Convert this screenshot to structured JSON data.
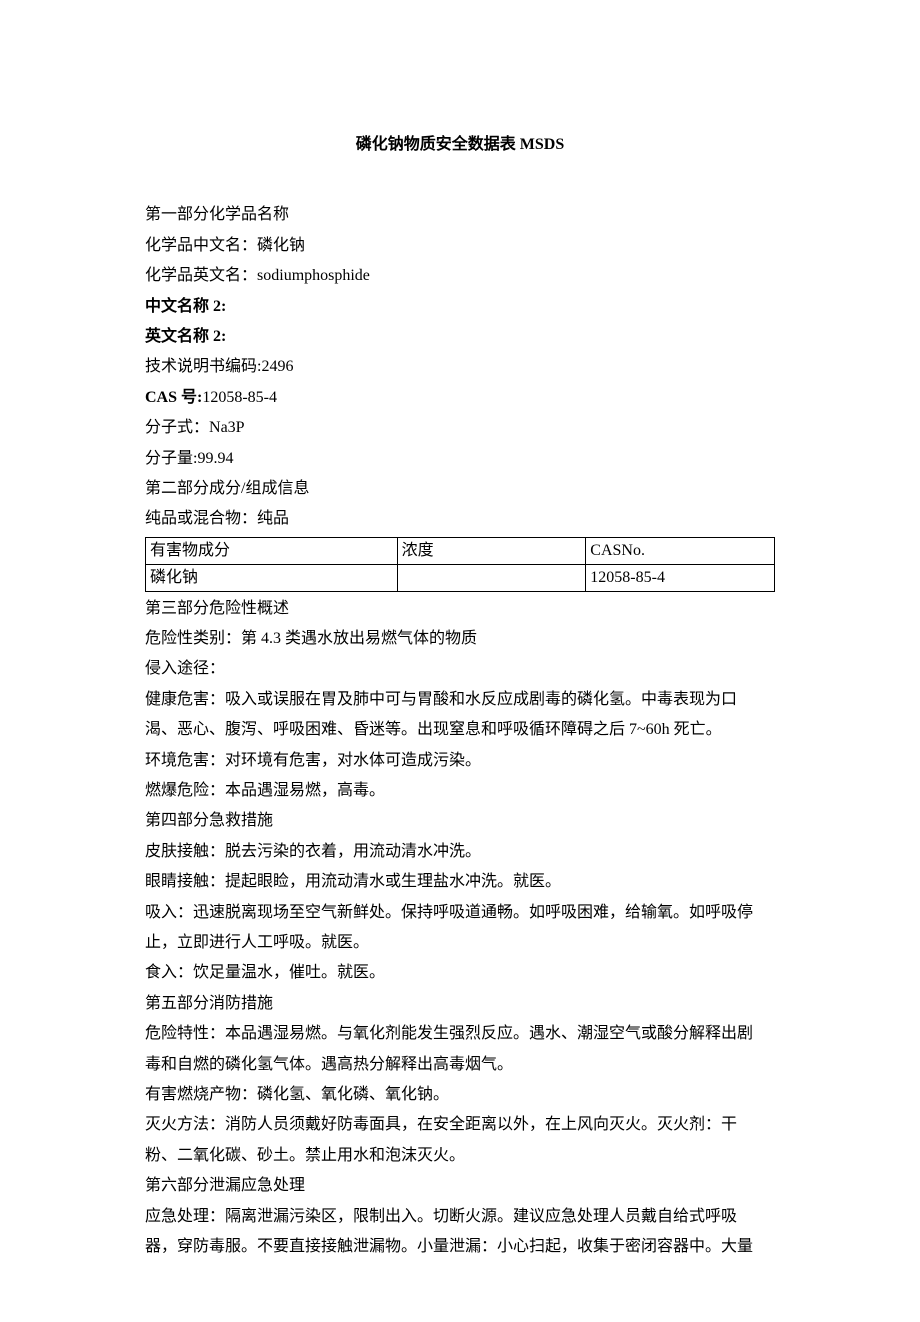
{
  "title": "磷化钠物质安全数据表 MSDS",
  "section1": {
    "header": "第一部分化学品名称",
    "nameCnLabel": "化学品中文名：",
    "nameCn": "磷化钠",
    "nameEnLabel": "化学品英文名：",
    "nameEn": "sodiumphosphide",
    "cnName2Label": "中文名称 2:",
    "enName2Label": "英文名称 2:",
    "techCodeLabel": "技术说明书编码:",
    "techCode": "2496",
    "casLabel": "CAS 号:",
    "cas": "12058-85-4",
    "formulaLabel": "分子式：",
    "formula": "Na3P",
    "mwLabel": "分子量:",
    "mw": "99.94"
  },
  "section2": {
    "header": "第二部分成分/组成信息",
    "pureLabel": "纯品或混合物：",
    "pure": "纯品",
    "tableHeaders": {
      "component": "有害物成分",
      "concentration": "浓度",
      "cas": "CASNo."
    },
    "tableRow": {
      "component": "磷化钠",
      "concentration": "",
      "cas": "12058-85-4"
    }
  },
  "section3": {
    "header": "第三部分危险性概述",
    "categoryLabel": "危险性类别：",
    "category": "第 4.3 类遇水放出易燃气体的物质",
    "routeLabel": "侵入途径：",
    "healthLine1": "健康危害：吸入或误服在胃及肺中可与胃酸和水反应成剧毒的磷化氢。中毒表现为口",
    "healthLine2": "渴、恶心、腹泻、呼吸困难、昏迷等。出现窒息和呼吸循环障碍之后 7~60h 死亡。",
    "envLabel": "环境危害：",
    "env": "对环境有危害，对水体可造成污染。",
    "explodeLabel": "燃爆危险：",
    "explode": "本品遇湿易燃，高毒。"
  },
  "section4": {
    "header": "第四部分急救措施",
    "skinLabel": "皮肤接触：",
    "skin": "脱去污染的衣着，用流动清水冲洗。",
    "eyeLabel": "眼睛接触：",
    "eye": "提起眼睑，用流动清水或生理盐水冲洗。就医。",
    "inhaleLine1": "吸入：迅速脱离现场至空气新鲜处。保持呼吸道通畅。如呼吸困难，给输氧。如呼吸停",
    "inhaleLine2": "止，立即进行人工呼吸。就医。",
    "ingestLabel": "食入：",
    "ingest": "饮足量温水，催吐。就医。"
  },
  "section5": {
    "header": "第五部分消防措施",
    "hazardLine1": "危险特性：本品遇湿易燃。与氧化剂能发生强烈反应。遇水、潮湿空气或酸分解释出剧",
    "hazardLine2": "毒和自燃的磷化氢气体。遇高热分解释出高毒烟气。",
    "combustLabel": "有害燃烧产物：",
    "combust": "磷化氢、氧化磷、氧化钠。",
    "extinguishLine1": "灭火方法：消防人员须戴好防毒面具，在安全距离以外，在上风向灭火。灭火剂：干",
    "extinguishLine2": "粉、二氧化碳、砂土。禁止用水和泡沫灭火。"
  },
  "section6": {
    "header": "第六部分泄漏应急处理",
    "emergencyLine1": "应急处理：隔离泄漏污染区，限制出入。切断火源。建议应急处理人员戴自给式呼吸",
    "emergencyLine2": "器，穿防毒服。不要直接接触泄漏物。小量泄漏：小心扫起，收集于密闭容器中。大量"
  }
}
